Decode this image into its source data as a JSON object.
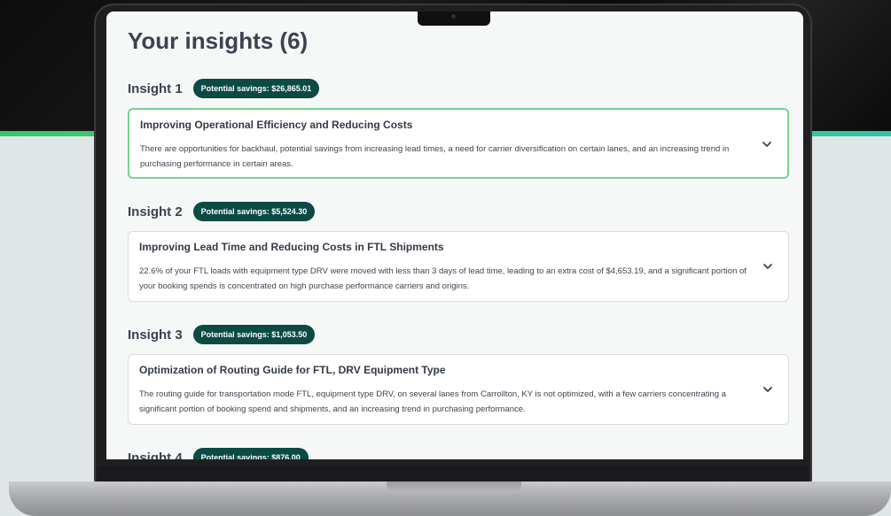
{
  "page": {
    "title": "Your insights (6)"
  },
  "insights": [
    {
      "label": "Insight 1",
      "savings": "Potential savings: $26,865.01",
      "title": "Improving Operational Efficiency and Reducing Costs",
      "body": "There are opportunities for backhaul, potential savings from increasing lead times, a need for carrier diversification on certain lanes, and an increasing trend in purchasing performance in certain areas."
    },
    {
      "label": "Insight 2",
      "savings": "Potential savings: $5,524.30",
      "title": "Improving Lead Time and Reducing Costs in FTL Shipments",
      "body": "22.6% of your FTL loads with equipment type DRV were moved with less than 3 days of lead time, leading to an extra cost of $4,653.19, and a significant portion of your booking spends is concentrated on high purchase performance carriers and origins."
    },
    {
      "label": "Insight 3",
      "savings": "Potential savings: $1,053.50",
      "title": "Optimization of Routing Guide for FTL, DRV Equipment Type",
      "body": "The routing guide for transportation mode FTL, equipment type DRV, on several lanes from Carrollton, KY is not optimized, with a few carriers concentrating a significant portion of booking spend and shipments, and an increasing trend in purchasing performance."
    },
    {
      "label": "Insight 4",
      "savings": "Potential savings: $876.00"
    }
  ],
  "icons": {
    "expand": "chevron-down-icon"
  },
  "colors": {
    "badge": "#0b4b44",
    "active_border": "#7ad38e",
    "accent_stripe": "#35c86a"
  }
}
